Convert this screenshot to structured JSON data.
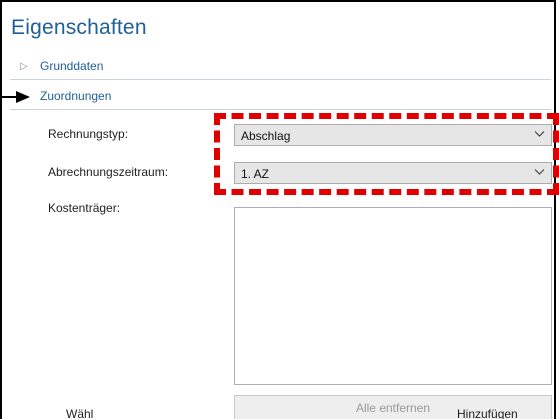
{
  "panel": {
    "title": "Eigenschaften",
    "sections": [
      {
        "label": "Grunddaten",
        "expanded": false
      },
      {
        "label": "Zuordnungen",
        "expanded": true
      }
    ]
  },
  "fields": {
    "rechnungstyp": {
      "label": "Rechnungstyp:",
      "value": "Abschlag"
    },
    "abrechnungszeitraum": {
      "label": "Abrechnungszeitraum:",
      "value": "1. AZ"
    },
    "kostentraeger": {
      "label": "Kostenträger:"
    }
  },
  "buttons": {
    "remove_all": "Alle entfernen"
  },
  "annotation": {
    "color": "#e00000"
  },
  "partial_text": {
    "left": "Wähl",
    "right": "Hinzufügen"
  },
  "icons": {
    "expand": "triangle-right-icon",
    "dropdown": "chevron-down-icon"
  }
}
